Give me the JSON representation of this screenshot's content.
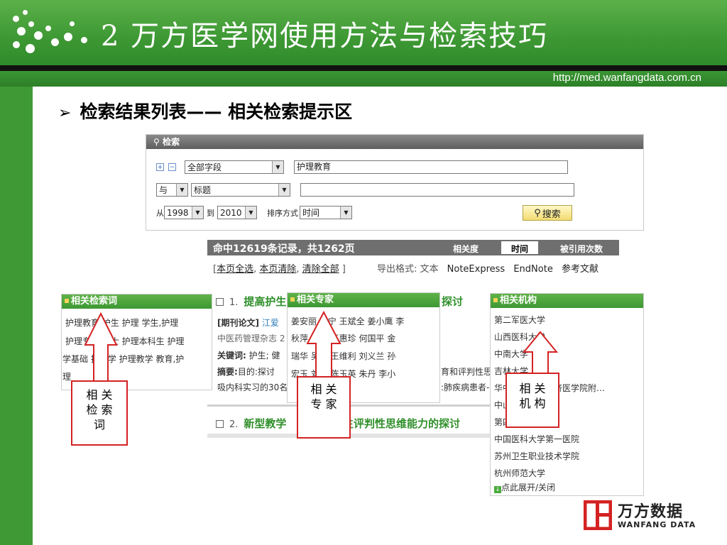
{
  "slide": {
    "title": "2  万方医学网使用方法与检索技巧",
    "url": "http://med.wanfangdata.com.cn",
    "heading_bullet": "➢",
    "heading": "检索结果列表——  相关检索提示区"
  },
  "search": {
    "bar_label": "检索",
    "field1": "全部字段",
    "query1": "护理教育",
    "logic": "与",
    "field2": "标题",
    "query2": "",
    "from_label": "从",
    "from_year": "1998",
    "to_label": "到",
    "to_year": "2010",
    "sort_label": "排序方式",
    "sort_value": "时间",
    "search_button": "搜索"
  },
  "results": {
    "summary": "命中12619条记录，共1262页",
    "sort_tabs": [
      "相关度",
      "时间",
      "被引用次数"
    ],
    "actions": [
      "本页全选",
      "本页清除",
      "清除全部"
    ],
    "export_label": "导出格式: 文本",
    "export_options": [
      "NoteExpress",
      "EndNote",
      "参考文献"
    ],
    "items": [
      {
        "num": "1.",
        "title_a": "提高护生",
        "title_b": "探讨",
        "type": "[期刊论文]",
        "author_frag": "江爱",
        "journal": "中医药管理杂志 2",
        "kw_label": "关键词:",
        "kw_frag": "护生; 健",
        "abs_label": "摘要:",
        "abs_frag": "目的:探讨",
        "abs_tail1": "育和评判性思",
        "abs_tail2": ":肺疾病患者-",
        "abs_line3": "吸内科实习的30名"
      },
      {
        "num": "2.",
        "title_a": "新型教学",
        "title_b": "生评判性思维能力的探讨"
      }
    ]
  },
  "panels": {
    "keywords": {
      "title": "相关检索词",
      "lines": [
        "护理教育  护生  护理  学生,护理",
        "护理专业  护士  护理本科生  护理",
        "学基础  护理学  护理教学  教育,护",
        "理"
      ]
    },
    "experts": {
      "title": "相关专家",
      "lines": [
        "姜安丽  沈宁  王斌全  姜小鹰  李",
        "秋萍  刘杰  王惠珍  何国平  金",
        "瑞华  吴丽  王维利  刘义兰  孙",
        "宏玉  刘红  陈玉英  朱丹  李小"
      ]
    },
    "institutions": {
      "title": "相关机构",
      "lines": [
        "第二军医大学",
        "山西医科大学",
        "中南大学",
        "吉林大学",
        "华中科技大学同济医学院附…",
        "中山大学",
        "第四军医大学",
        "中国医科大学第一医院",
        "苏州卫生职业技术学院",
        "杭州师范大学"
      ],
      "toggle": "点此展开/关闭"
    }
  },
  "callouts": {
    "keywords": [
      "相  关",
      "检  索",
      "词"
    ],
    "experts": [
      "相  关",
      "专  家"
    ],
    "institutions": [
      "相  关",
      "机  构"
    ]
  },
  "logo": {
    "cn": "万方数据",
    "en": "WANFANG DATA"
  },
  "colors": {
    "green": "#3f9a35",
    "red": "#d42222",
    "title_green": "#2f8f2a"
  }
}
